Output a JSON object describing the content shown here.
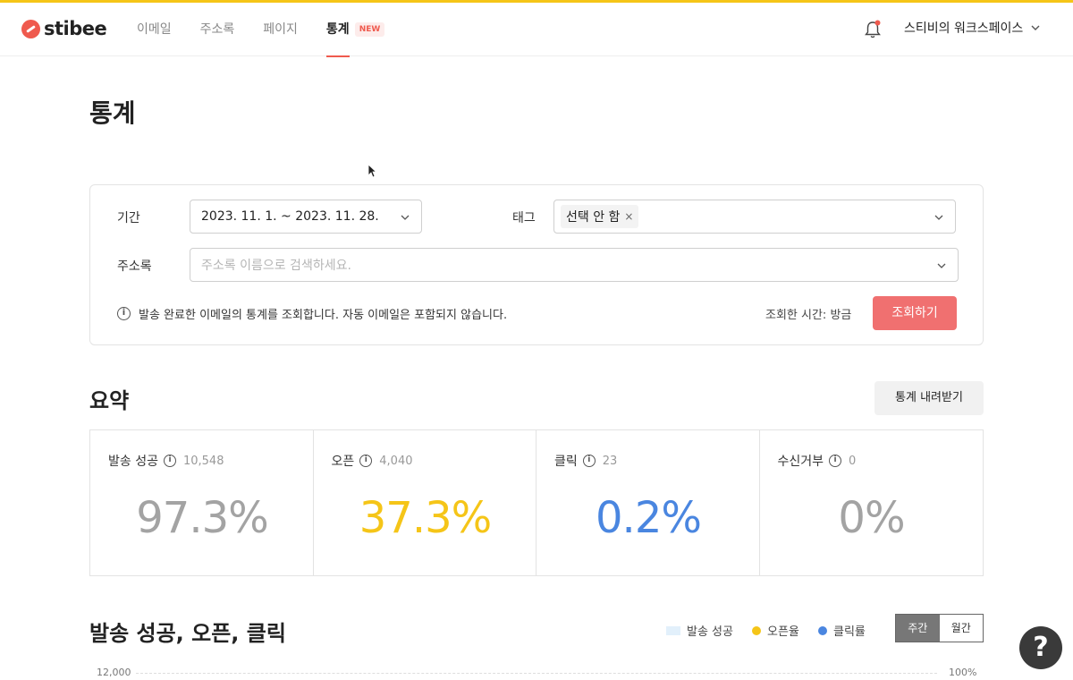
{
  "header": {
    "logo_text": "stibee",
    "nav": [
      {
        "label": "이메일"
      },
      {
        "label": "주소록"
      },
      {
        "label": "페이지"
      },
      {
        "label": "통계",
        "badge": "NEW",
        "active": true
      }
    ],
    "workspace": "스티비의 워크스페이스",
    "icons": {
      "bell": "bell-icon",
      "chevron": "chevron-down-icon"
    },
    "colors": {
      "accent_bar": "#f5c518",
      "brand": "#ef5a4e"
    }
  },
  "page": {
    "title": "통계"
  },
  "filters": {
    "period_label": "기간",
    "period_value": "2023. 11. 1. ~ 2023. 11. 28.",
    "tag_label": "태그",
    "tag_chip": "선택 안 함",
    "tag_chip_remove": "×",
    "addressbook_label": "주소록",
    "addressbook_placeholder": "주소록 이름으로 검색하세요.",
    "info_text": "발송 완료한 이메일의 통계를 조회합니다. 자동 이메일은 포함되지 않습니다.",
    "query_time": "조회한 시간: 방금",
    "query_button": "조회하기"
  },
  "summary": {
    "title": "요약",
    "download_button": "통계 내려받기",
    "cards": [
      {
        "label": "발송 성공",
        "count": "10,548",
        "value": "97.3%",
        "color": "#a3a3a3"
      },
      {
        "label": "오픈",
        "count": "4,040",
        "value": "37.3%",
        "color": "#f5c518"
      },
      {
        "label": "클릭",
        "count": "23",
        "value": "0.2%",
        "color": "#4a86e0"
      },
      {
        "label": "수신거부",
        "count": "0",
        "value": "0%",
        "color": "#a3a3a3"
      }
    ]
  },
  "chart_section": {
    "title": "발송 성공, 오픈, 클릭",
    "legend": [
      {
        "label": "발송 성공",
        "color": "#e2f0fb"
      },
      {
        "label": "오픈율",
        "color": "#f5c518"
      },
      {
        "label": "클릭률",
        "color": "#4a86e0"
      }
    ],
    "toggle": [
      {
        "label": "주간",
        "active": true
      },
      {
        "label": "월간",
        "active": false
      }
    ],
    "y_left_top": "12,000",
    "y_right_top": "100%"
  },
  "help_button": "?"
}
